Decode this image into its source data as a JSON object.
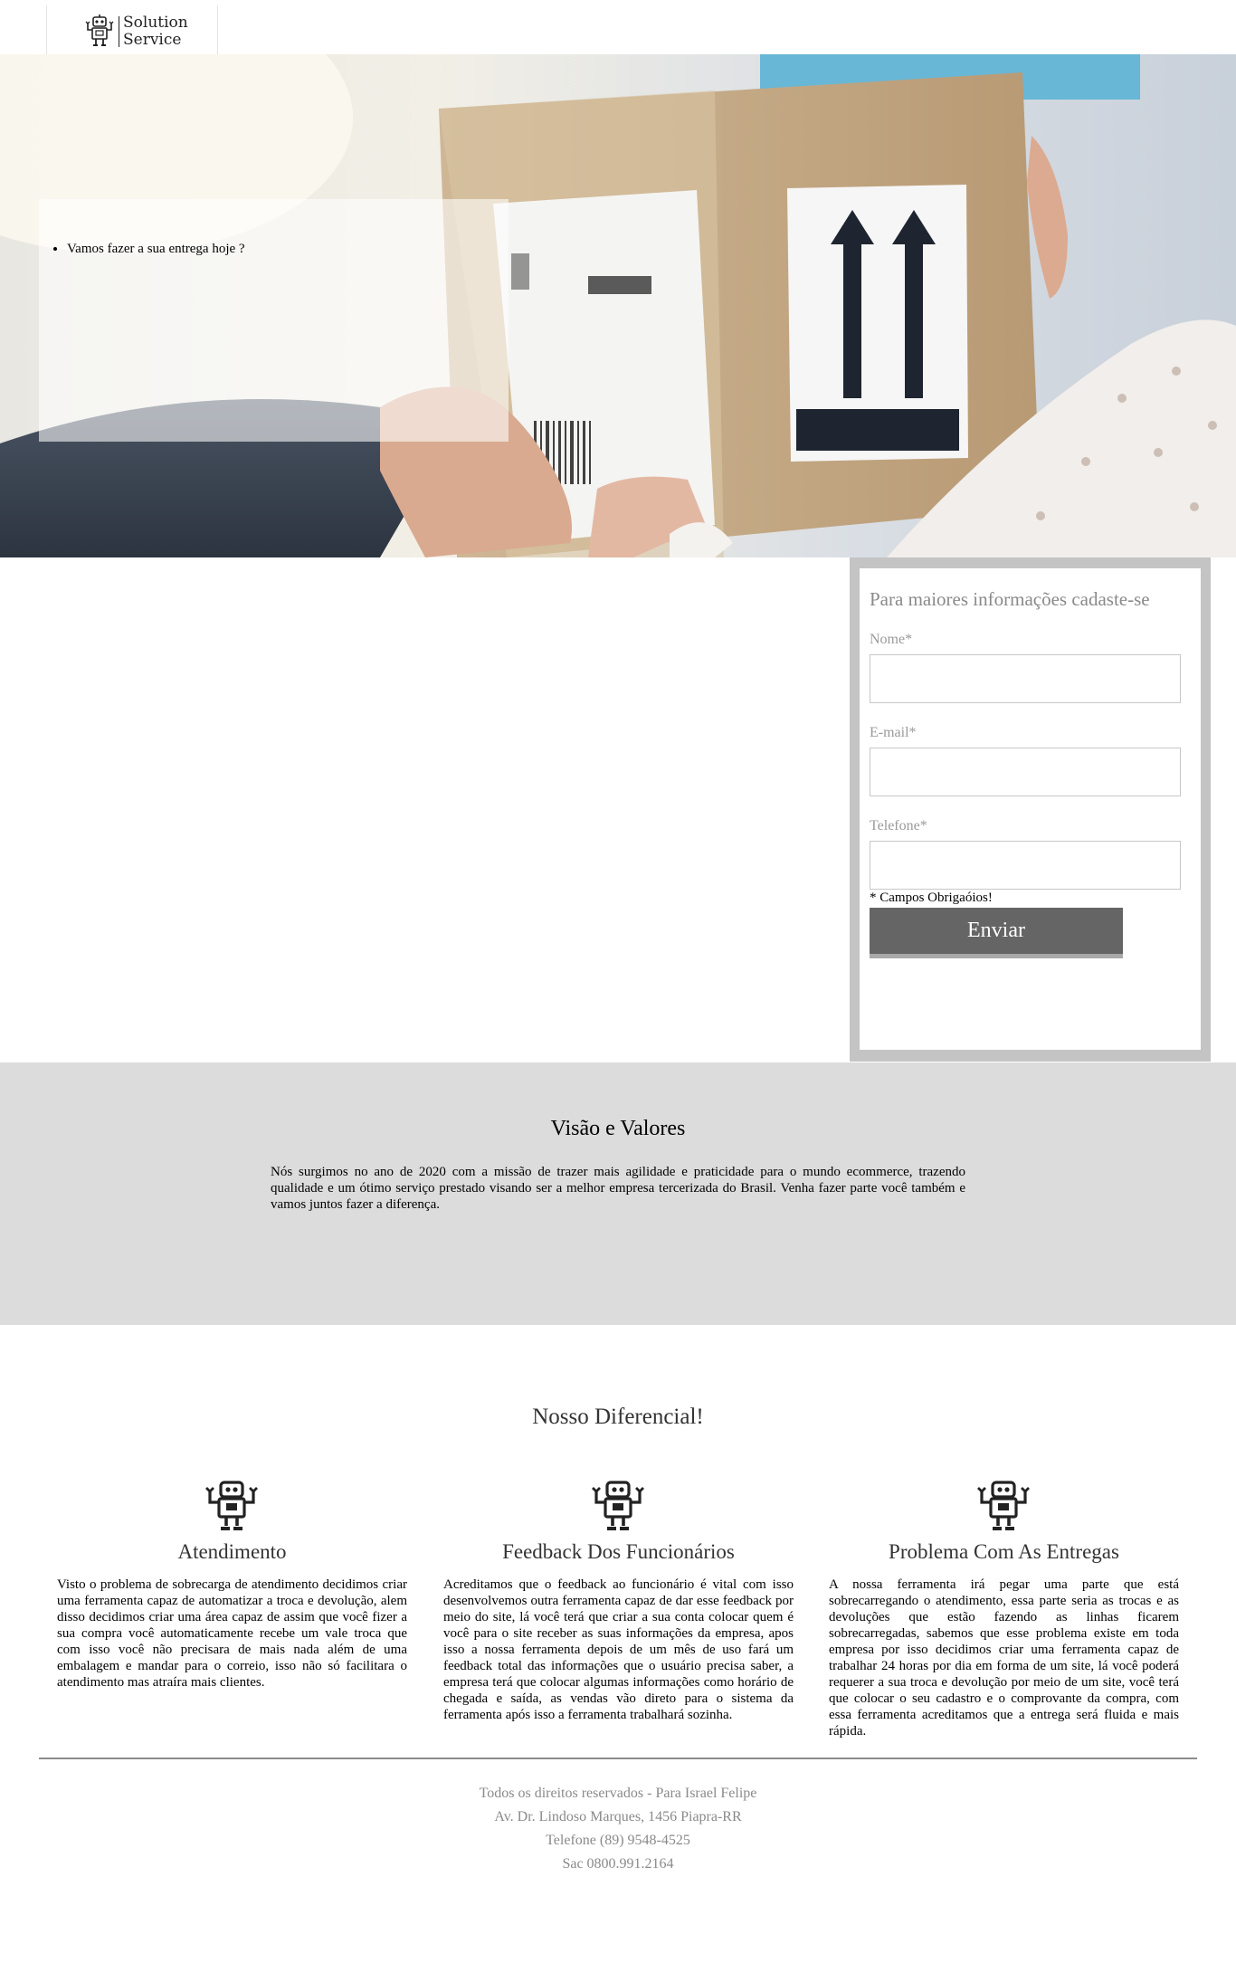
{
  "brand": {
    "line1": "Solution",
    "line2": "Service",
    "logo_icon": "robot-icon"
  },
  "hero": {
    "bullet": "Vamos fazer a sua entrega hoje ?"
  },
  "form": {
    "title": "Para maiores informações cadaste-se",
    "name_label": "Nome*",
    "email_label": "E-mail*",
    "phone_label": "Telefone*",
    "name_value": "",
    "email_value": "",
    "phone_value": "",
    "required_note": "* Campos Obrigaóios!",
    "submit_label": "Enviar"
  },
  "vision": {
    "title": "Visão e Valores",
    "text": "Nós surgimos no ano de 2020 com a missão de trazer mais agilidade e praticidade para o mundo ecommerce, trazendo qualidade e um ótimo serviço prestado visando ser a melhor empresa tercerizada do Brasil. Venha fazer parte você também e vamos juntos fazer a diferença."
  },
  "diferencial": {
    "title": "Nosso Diferencial!",
    "items": [
      {
        "icon": "robot-icon",
        "title": "Atendimento",
        "text": "Visto o problema de sobrecarga de atendimento decidimos criar uma ferramenta capaz de automatizar a troca e devolução, alem disso decidimos criar uma área capaz de assim que você fizer a sua compra você automaticamente recebe um vale troca que com isso você não precisara de mais nada além de uma embalagem e mandar para o correio, isso não só facilitara o atendimento mas atraíra mais clientes."
      },
      {
        "icon": "robot-icon",
        "title": "Feedback Dos Funcionários",
        "text": "Acreditamos que o feedback ao funcionário é vital com isso desenvolvemos outra ferramenta capaz de dar esse feedback por meio do site, lá você terá que criar a sua conta colocar quem é você para o site receber as suas informações da empresa, apos isso a nossa ferramenta depois de um mês de uso fará um feedback total das informações que o usuário precisa saber, a empresa terá que colocar algumas informações como horário de chegada e saída, as vendas vão direto para o sistema da ferramenta após isso a ferramenta trabalhará sozinha."
      },
      {
        "icon": "robot-icon",
        "title": "Problema Com As Entregas",
        "text": "A nossa ferramenta irá pegar uma parte que está sobrecarregando o atendimento, essa parte seria as trocas e as devoluções que estão fazendo as linhas ficarem sobrecarregadas, sabemos que esse problema existe em toda empresa por isso decidimos criar uma ferramenta capaz de trabalhar 24 horas por dia em forma de um site, lá você poderá requerer a sua troca e devolução por meio de um site, você terá que colocar o seu cadastro e o comprovante da compra, com essa ferramenta acreditamos que a entrega será fluida e mais rápida."
      }
    ]
  },
  "footer": {
    "rights": "Todos os direitos reservados - Para Israel Felipe",
    "address": "Av. Dr. Lindoso Marques, 1456 Piapra-RR",
    "phone": "Telefone (89) 9548-4525",
    "sac": "Sac 0800.991.2164"
  },
  "colors": {
    "accent_button": "#656565",
    "band_gray": "#dcdcdc",
    "form_border": "#c4c4c4"
  }
}
